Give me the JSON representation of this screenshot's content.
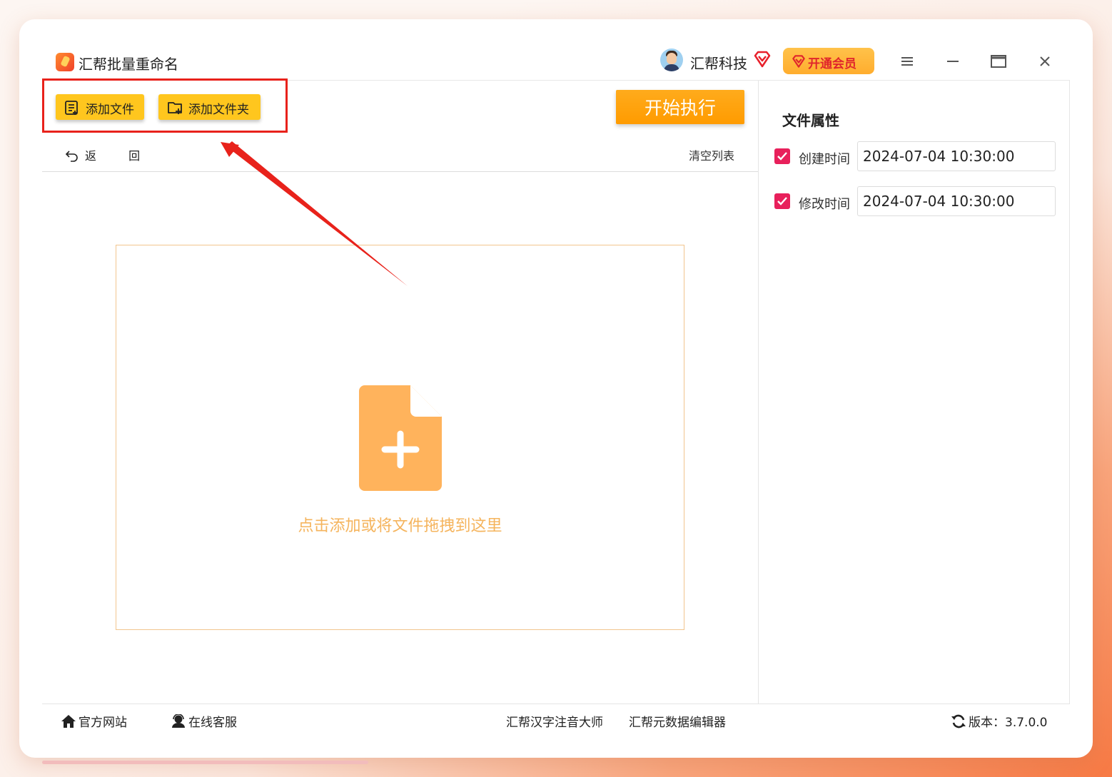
{
  "app": {
    "title": "汇帮批量重命名"
  },
  "user": {
    "name": "汇帮科技"
  },
  "header": {
    "vip_label": "开通会员"
  },
  "toolbar": {
    "add_file": "添加文件",
    "add_folder": "添加文件夹",
    "start": "开始执行",
    "back": "返 回",
    "clear_list": "清空列表"
  },
  "dropzone": {
    "text": "点击添加或将文件拖拽到这里"
  },
  "properties": {
    "title": "文件属性",
    "created": {
      "label": "创建时间",
      "value": "2024-07-04 10:30:00",
      "checked": true
    },
    "modified": {
      "label": "修改时间",
      "value": "2024-07-04 10:30:00",
      "checked": true
    }
  },
  "footer": {
    "website": "官方网站",
    "support": "在线客服",
    "product1": "汇帮汉字注音大师",
    "product2": "汇帮元数据编辑器",
    "version": "版本：3.7.0.0"
  },
  "colors": {
    "accent": "#ffc61e",
    "start": "#ff9b00",
    "highlight": "#e8221b",
    "check": "#e8205b",
    "drop_text": "#f5b45d"
  }
}
